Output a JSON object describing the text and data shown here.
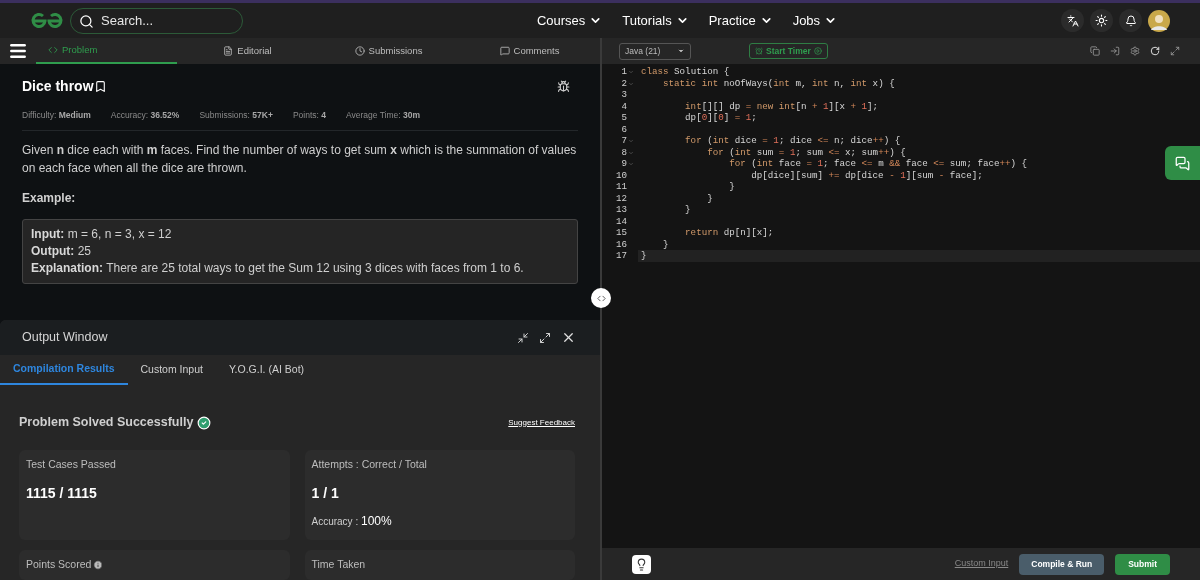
{
  "nav": {
    "search_placeholder": "Search...",
    "links": [
      "Courses",
      "Tutorials",
      "Practice",
      "Jobs"
    ]
  },
  "problem_tabs": [
    {
      "label": "Problem",
      "selected": true
    },
    {
      "label": "Editorial",
      "selected": false
    },
    {
      "label": "Submissions",
      "selected": false
    },
    {
      "label": "Comments",
      "selected": false
    }
  ],
  "problem": {
    "title": "Dice throw",
    "meta": [
      {
        "label": "Difficulty:",
        "value": "Medium"
      },
      {
        "label": "Accuracy:",
        "value": "36.52%"
      },
      {
        "label": "Submissions:",
        "value": "57K+"
      },
      {
        "label": "Points:",
        "value": "4"
      },
      {
        "label": "Average Time:",
        "value": "30m"
      }
    ],
    "description": "Given **n** dice each with **m** faces. Find the number of ways to get sum **x** which is the summation of values on each face when all the dice are thrown.",
    "example_heading": "Example:",
    "example": [
      {
        "label": "Input:",
        "value": "m = 6, n = 3, x = 12"
      },
      {
        "label": "Output:",
        "value": "25"
      },
      {
        "label": "Explanation:",
        "value": "There are 25 total ways to get the Sum 12 using 3 dices with faces from 1 to 6."
      }
    ]
  },
  "output_window": {
    "title": "Output Window",
    "tabs": [
      {
        "label": "Compilation Results",
        "selected": true
      },
      {
        "label": "Custom Input",
        "selected": false
      },
      {
        "label": "Y.O.G.I. (AI Bot)",
        "selected": false
      }
    ],
    "status": "Problem Solved Successfully",
    "feedback_link": "Suggest Feedback",
    "cards": [
      {
        "title": "Test Cases Passed",
        "value": "1115 / 1115"
      },
      {
        "title": "Attempts : Correct / Total",
        "value": "1 / 1",
        "note_label": "Accuracy :",
        "note_value": "100%"
      },
      {
        "title": "Points Scored",
        "info": true
      },
      {
        "title": "Time Taken",
        "info": false
      }
    ]
  },
  "editor": {
    "language": "Java (21)",
    "timer_button": "Start Timer",
    "lines": [
      {
        "number": "1",
        "foldable": true,
        "active": false,
        "tokens": [
          {
            "kind": "kw",
            "t": "class"
          },
          {
            "kind": "pl",
            "t": " Solution {"
          }
        ]
      },
      {
        "number": "2",
        "foldable": true,
        "active": false,
        "tokens": [
          {
            "kind": "kw",
            "t": "    static int"
          },
          {
            "kind": "pl",
            "t": " noOfWays("
          },
          {
            "kind": "kw",
            "t": "int"
          },
          {
            "kind": "pl",
            "t": " m, "
          },
          {
            "kind": "kw",
            "t": "int"
          },
          {
            "kind": "pl",
            "t": " n, "
          },
          {
            "kind": "kw",
            "t": "int"
          },
          {
            "kind": "pl",
            "t": " x) {"
          }
        ]
      },
      {
        "number": "3",
        "foldable": false,
        "active": false
      },
      {
        "number": "4",
        "foldable": false,
        "active": false,
        "tokens": [
          {
            "kind": "kw",
            "t": "        int"
          },
          {
            "kind": "pl",
            "t": "[][] dp "
          },
          {
            "kind": "op",
            "t": "= "
          },
          {
            "kind": "kw",
            "t": "new int"
          },
          {
            "kind": "pl",
            "t": "[n "
          },
          {
            "kind": "op",
            "t": "+ "
          },
          {
            "kind": "num",
            "t": "1"
          },
          {
            "kind": "pl",
            "t": "][x "
          },
          {
            "kind": "op",
            "t": "+ "
          },
          {
            "kind": "num",
            "t": "1"
          },
          {
            "kind": "pl",
            "t": "];"
          }
        ]
      },
      {
        "number": "5",
        "foldable": false,
        "active": false,
        "tokens": [
          {
            "kind": "pl",
            "t": "        dp["
          },
          {
            "kind": "num",
            "t": "0"
          },
          {
            "kind": "pl",
            "t": "]["
          },
          {
            "kind": "num",
            "t": "0"
          },
          {
            "kind": "pl",
            "t": "] "
          },
          {
            "kind": "op",
            "t": "= "
          },
          {
            "kind": "num",
            "t": "1"
          },
          {
            "kind": "pl",
            "t": ";"
          }
        ]
      },
      {
        "number": "6",
        "foldable": false,
        "active": false
      },
      {
        "number": "7",
        "foldable": true,
        "active": false,
        "tokens": [
          {
            "kind": "kw",
            "t": "        for"
          },
          {
            "kind": "pl",
            "t": " ("
          },
          {
            "kind": "kw",
            "t": "int"
          },
          {
            "kind": "pl",
            "t": " dice "
          },
          {
            "kind": "op",
            "t": "= "
          },
          {
            "kind": "num",
            "t": "1"
          },
          {
            "kind": "pl",
            "t": "; dice "
          },
          {
            "kind": "op",
            "t": "<="
          },
          {
            "kind": "pl",
            "t": " n; dice"
          },
          {
            "kind": "op",
            "t": "++"
          },
          {
            "kind": "pl",
            "t": ") {"
          }
        ]
      },
      {
        "number": "8",
        "foldable": true,
        "active": false,
        "tokens": [
          {
            "kind": "kw",
            "t": "            for"
          },
          {
            "kind": "pl",
            "t": " ("
          },
          {
            "kind": "kw",
            "t": "int"
          },
          {
            "kind": "pl",
            "t": " sum "
          },
          {
            "kind": "op",
            "t": "= "
          },
          {
            "kind": "num",
            "t": "1"
          },
          {
            "kind": "pl",
            "t": "; sum "
          },
          {
            "kind": "op",
            "t": "<="
          },
          {
            "kind": "pl",
            "t": " x; sum"
          },
          {
            "kind": "op",
            "t": "++"
          },
          {
            "kind": "pl",
            "t": ") {"
          }
        ]
      },
      {
        "number": "9",
        "foldable": true,
        "active": false,
        "tokens": [
          {
            "kind": "kw",
            "t": "                for"
          },
          {
            "kind": "pl",
            "t": " ("
          },
          {
            "kind": "kw",
            "t": "int"
          },
          {
            "kind": "pl",
            "t": " face "
          },
          {
            "kind": "op",
            "t": "= "
          },
          {
            "kind": "num",
            "t": "1"
          },
          {
            "kind": "pl",
            "t": "; face "
          },
          {
            "kind": "op",
            "t": "<="
          },
          {
            "kind": "pl",
            "t": " m "
          },
          {
            "kind": "op",
            "t": "&&"
          },
          {
            "kind": "pl",
            "t": " face "
          },
          {
            "kind": "op",
            "t": "<="
          },
          {
            "kind": "pl",
            "t": " sum; face"
          },
          {
            "kind": "op",
            "t": "++"
          },
          {
            "kind": "pl",
            "t": ") {"
          }
        ]
      },
      {
        "number": "10",
        "foldable": false,
        "active": false,
        "tokens": [
          {
            "kind": "pl",
            "t": "                    dp[dice][sum] "
          },
          {
            "kind": "op",
            "t": "+="
          },
          {
            "kind": "pl",
            "t": " dp[dice "
          },
          {
            "kind": "op",
            "t": "- "
          },
          {
            "kind": "num",
            "t": "1"
          },
          {
            "kind": "pl",
            "t": "][sum "
          },
          {
            "kind": "op",
            "t": "-"
          },
          {
            "kind": "pl",
            "t": " face];"
          }
        ]
      },
      {
        "number": "11",
        "foldable": false,
        "active": false,
        "tokens": [
          {
            "kind": "pl",
            "t": "                }"
          }
        ]
      },
      {
        "number": "12",
        "foldable": false,
        "active": false,
        "tokens": [
          {
            "kind": "pl",
            "t": "            }"
          }
        ]
      },
      {
        "number": "13",
        "foldable": false,
        "active": false,
        "tokens": [
          {
            "kind": "pl",
            "t": "        }"
          }
        ]
      },
      {
        "number": "14",
        "foldable": false,
        "active": false
      },
      {
        "number": "15",
        "foldable": false,
        "active": false,
        "tokens": [
          {
            "kind": "kw",
            "t": "        return"
          },
          {
            "kind": "pl",
            "t": " dp[n][x];"
          }
        ]
      },
      {
        "number": "16",
        "foldable": false,
        "active": false,
        "tokens": [
          {
            "kind": "pl",
            "t": "    }"
          }
        ]
      },
      {
        "number": "17",
        "foldable": false,
        "active": true,
        "tokens": [
          {
            "kind": "pl",
            "t": "}"
          }
        ]
      }
    ],
    "custom_input_link": "Custom Input",
    "compile_button": "Compile & Run",
    "submit_button": "Submit"
  }
}
